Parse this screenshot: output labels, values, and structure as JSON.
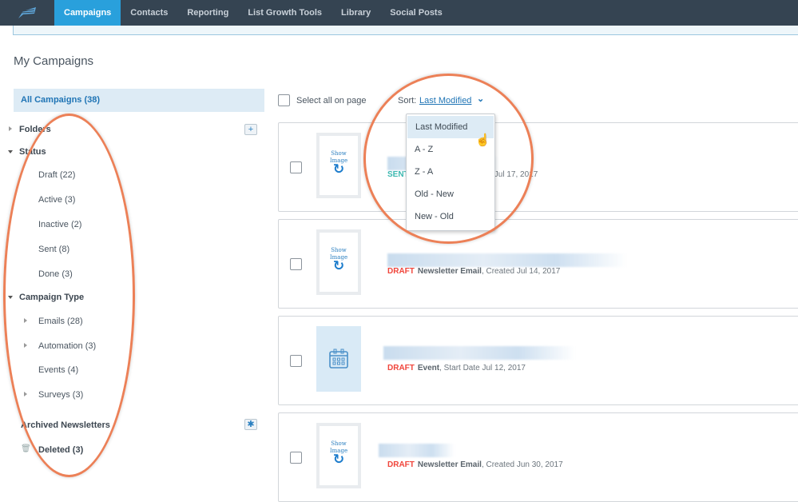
{
  "nav": {
    "items": [
      "Campaigns",
      "Contacts",
      "Reporting",
      "List Growth Tools",
      "Library",
      "Social Posts"
    ],
    "active": "Campaigns"
  },
  "page_title": "My Campaigns",
  "sidebar": {
    "all": "All Campaigns (38)",
    "folders": "Folders",
    "add_folder": "+",
    "status": "Status",
    "status_items": [
      "Draft (22)",
      "Active (3)",
      "Inactive (2)",
      "Sent (8)",
      "Done (3)"
    ],
    "campaign_type": "Campaign Type",
    "type_items": [
      "Emails (28)",
      "Automation (3)",
      "Events (4)",
      "Surveys (3)"
    ],
    "archived": "Archived Newsletters",
    "deleted": "Deleted (3)"
  },
  "toolbar": {
    "select_all": "Select all on page",
    "sort_label": "Sort:",
    "sort_value": "Last Modified"
  },
  "sort_options": [
    "Last Modified",
    "A - Z",
    "Z - A",
    "Old - New",
    "New - Old"
  ],
  "thumb": {
    "show": "Show",
    "image": "Image"
  },
  "campaigns": [
    {
      "status": "SENT",
      "type": "",
      "detail": "nt Jul 17, 2017",
      "status_color": "#3db8b0"
    },
    {
      "status": "DRAFT",
      "type": "Newsletter Email",
      "detail": ", Created Jul 14, 2017",
      "status_color": "#f0463c"
    },
    {
      "status": "DRAFT",
      "type": "Event",
      "detail": ", Start Date Jul 12, 2017",
      "status_color": "#f0463c"
    },
    {
      "status": "DRAFT",
      "type": "Newsletter Email",
      "detail": ", Created Jun 30, 2017",
      "status_color": "#f0463c"
    }
  ],
  "colors": {
    "nav": "#354452",
    "accent": "#29a0dc",
    "highlight": "#ec8057"
  }
}
